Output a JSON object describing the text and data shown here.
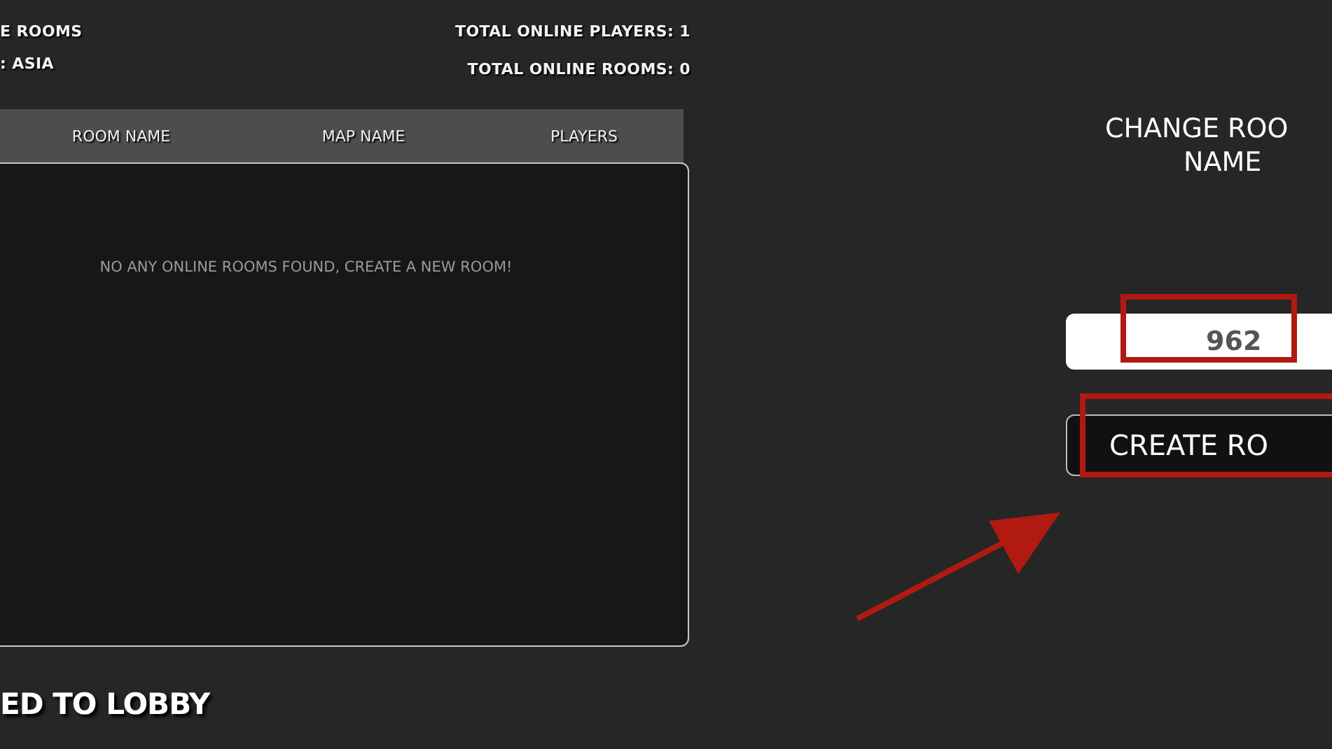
{
  "header": {
    "title_left": "E ROOMS",
    "region": ": ASIA",
    "total_players": "TOTAL ONLINE PLAYERS: 1",
    "total_rooms": "TOTAL ONLINE ROOMS: 0"
  },
  "table": {
    "columns": [
      "ROOM NAME",
      "MAP NAME",
      "PLAYERS"
    ],
    "empty_message": "NO ANY ONLINE ROOMS FOUND, CREATE A NEW ROOM!"
  },
  "status": "ED TO LOBBY",
  "room_panel": {
    "title_lines": [
      "CHANGE ROO",
      "NAME"
    ],
    "room_name_value": "962",
    "create_button": "CREATE RO"
  }
}
